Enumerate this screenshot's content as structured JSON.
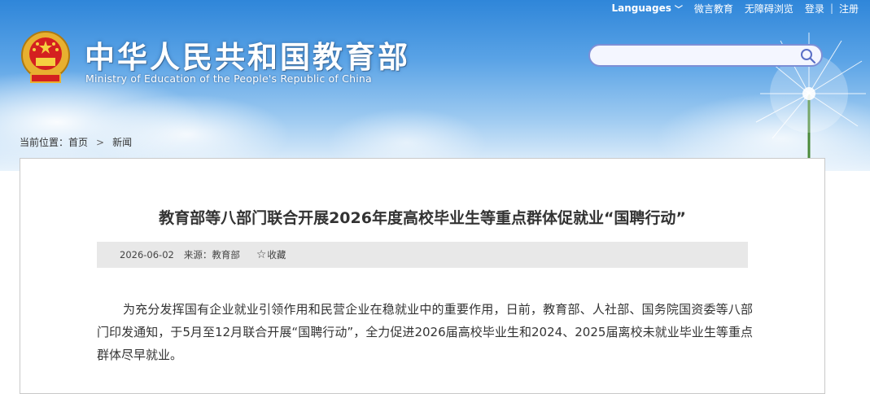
{
  "top_links": {
    "languages": "Languages",
    "weibo": "微言教育",
    "accessible": "无障碍浏览",
    "login": "登录",
    "separator": "|",
    "register": "注册"
  },
  "header": {
    "title": "中华人民共和国教育部",
    "subtitle": "Ministry of Education of the People's Republic of China"
  },
  "search": {
    "placeholder": "",
    "value": ""
  },
  "breadcrumb": {
    "label": "当前位置：",
    "home": "首页",
    "arrow": ">",
    "current": "新闻"
  },
  "article": {
    "title": "教育部等八部门联合开展2026年度高校毕业生等重点群体促就业“国聘行动”",
    "date": "2026-06-02",
    "source_label": "来源：",
    "source": "教育部",
    "favorite": "收藏",
    "body": "为充分发挥国有企业就业引领作用和民营企业在稳就业中的重要作用，日前，教育部、人社部、国务院国资委等八部门印发通知，于5月至12月联合开展“国聘行动”，全力促进2026届高校毕业生和2024、2025届离校未就业毕业生等重点群体尽早就业。"
  },
  "colors": {
    "sky_top": "#2f86d9",
    "search_border": "#7d8fd6",
    "meta_bg": "#e8e8e8",
    "text": "#333333"
  }
}
